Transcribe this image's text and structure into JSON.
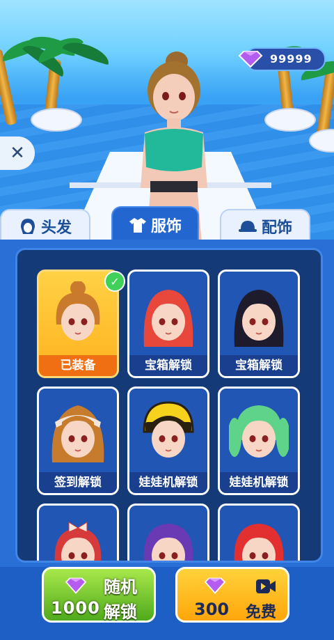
{
  "hud": {
    "gem_count": "99999",
    "close_glyph": "✕",
    "icons": [
      "gem-icon",
      "close-icon"
    ]
  },
  "tabs": [
    {
      "label": "头发",
      "icon": "hair-icon",
      "active": false
    },
    {
      "label": "服饰",
      "icon": "shirt-icon",
      "active": true
    },
    {
      "label": "配饰",
      "icon": "cap-icon",
      "active": false
    }
  ],
  "grid": {
    "items": [
      {
        "label": "已装备",
        "hair": "#c97a2d",
        "style": "bun",
        "equipped": true
      },
      {
        "label": "宝箱解锁",
        "hair": "#e8473b",
        "style": "long",
        "equipped": false
      },
      {
        "label": "宝箱解锁",
        "hair": "#1e1b2c",
        "style": "long",
        "equipped": false
      },
      {
        "label": "签到解锁",
        "hair": "#c77b2c",
        "style": "band",
        "equipped": false
      },
      {
        "label": "娃娃机解锁",
        "hair": "#2a2010",
        "style": "helmet",
        "equipped": false
      },
      {
        "label": "娃娃机解锁",
        "hair": "#5fd38a",
        "style": "twin",
        "equipped": false
      },
      {
        "label": "",
        "hair": "#d63a3a",
        "style": "bow",
        "equipped": false
      },
      {
        "label": "",
        "hair": "#6a3ab4",
        "style": "round",
        "equipped": false
      },
      {
        "label": "",
        "hair": "#e23030",
        "style": "round",
        "equipped": false
      }
    ],
    "check_glyph": "✓"
  },
  "buttons": {
    "random": {
      "line1": "随机",
      "cost": "1000",
      "line2": "解锁"
    },
    "free": {
      "cost": "300",
      "label": "免费"
    }
  },
  "colors": {
    "accent": "#2466d0",
    "panel": "#143b78",
    "gem": "#b45cf0"
  }
}
